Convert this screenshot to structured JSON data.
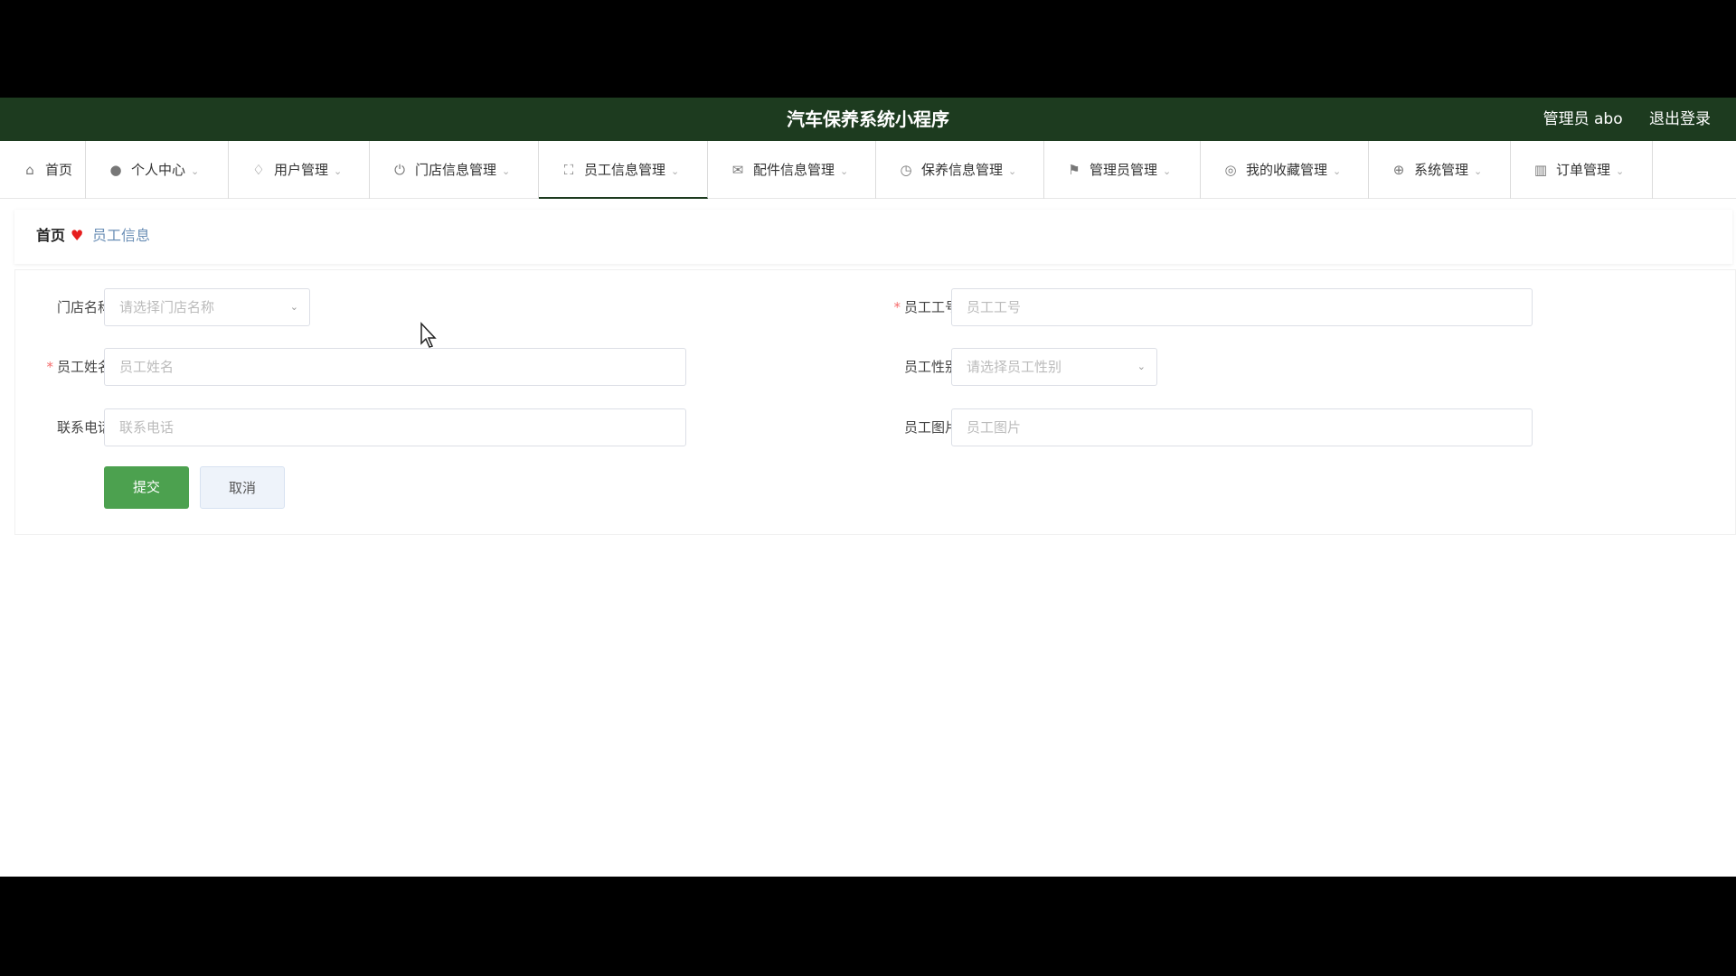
{
  "header": {
    "title": "汽车保养系统小程序",
    "user_label": "管理员 abo",
    "logout_label": "退出登录"
  },
  "nav": {
    "items": [
      {
        "label": "首页",
        "icon": "home-icon"
      },
      {
        "label": "个人中心",
        "icon": "user-icon"
      },
      {
        "label": "用户管理",
        "icon": "bell-off-icon"
      },
      {
        "label": "门店信息管理",
        "icon": "power-icon"
      },
      {
        "label": "员工信息管理",
        "icon": "fullscreen-icon"
      },
      {
        "label": "配件信息管理",
        "icon": "mail-icon"
      },
      {
        "label": "保养信息管理",
        "icon": "clock-icon"
      },
      {
        "label": "管理员管理",
        "icon": "flag-icon"
      },
      {
        "label": "我的收藏管理",
        "icon": "target-icon"
      },
      {
        "label": "系统管理",
        "icon": "globe-icon"
      },
      {
        "label": "订单管理",
        "icon": "chart-icon"
      }
    ],
    "active": "员工信息管理"
  },
  "breadcrumb": {
    "home": "首页",
    "separator_icon": "heart-icon",
    "current": "员工信息"
  },
  "form": {
    "store_name": {
      "label": "门店名称",
      "placeholder": "请选择门店名称",
      "required": false
    },
    "employee_no": {
      "label": "员工工号",
      "placeholder": "员工工号",
      "required": true
    },
    "employee_name": {
      "label": "员工姓名",
      "placeholder": "员工姓名",
      "required": true
    },
    "employee_gender": {
      "label": "员工性别",
      "placeholder": "请选择员工性别",
      "required": false
    },
    "phone": {
      "label": "联系电话",
      "placeholder": "联系电话",
      "required": false
    },
    "employee_photo": {
      "label": "员工图片",
      "placeholder": "员工图片",
      "required": false
    },
    "submit_label": "提交",
    "cancel_label": "取消"
  },
  "colors": {
    "header_bg": "#1d3b1f",
    "submit_bg": "#4ca14f",
    "required_mark": "#f56c6c",
    "heart": "#e61e1e"
  }
}
